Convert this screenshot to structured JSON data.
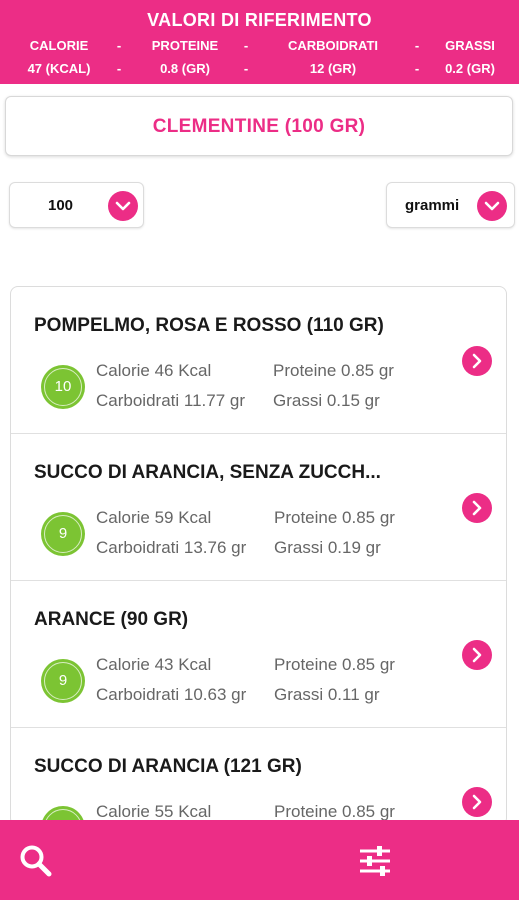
{
  "header": {
    "title": "VALORI DI RIFERIMENTO",
    "labels": {
      "calorie": "CALORIE",
      "proteine": "PROTEINE",
      "carboidrati": "CARBOIDRATI",
      "grassi": "GRASSI"
    },
    "values": {
      "calorie": "47 (KCAL)",
      "proteine": "0.8 (GR)",
      "carboidrati": "12 (GR)",
      "grassi": "0.2 (GR)"
    },
    "separator": "-"
  },
  "food": {
    "title": "CLEMENTINE   (100 GR)"
  },
  "quantity": {
    "value": "100",
    "icon": "chevron-down-icon"
  },
  "unit": {
    "value": "grammi",
    "icon": "chevron-down-icon"
  },
  "items": [
    {
      "name": "POMPELMO, ROSA E ROSSO (110 GR)",
      "score": "10",
      "calorie": "Calorie 46 Kcal",
      "proteine": "Proteine 0.85 gr",
      "carboidrati": "Carboidrati 11.77 gr",
      "grassi": "Grassi 0.15 gr"
    },
    {
      "name": "SUCCO DI ARANCIA, SENZA ZUCCH...",
      "score": "9",
      "calorie": "Calorie 59 Kcal",
      "proteine": "Proteine 0.85 gr",
      "carboidrati": "Carboidrati 13.76 gr",
      "grassi": "Grassi 0.19 gr"
    },
    {
      "name": "ARANCE (90 GR)",
      "score": "9",
      "calorie": "Calorie 43 Kcal",
      "proteine": "Proteine 0.85 gr",
      "carboidrati": "Carboidrati 10.63 gr",
      "grassi": "Grassi 0.11 gr"
    },
    {
      "name": "SUCCO DI ARANCIA (121 GR)",
      "score": "",
      "calorie": "Calorie 55 Kcal",
      "proteine": "Proteine 0.85 gr",
      "carboidrati": "",
      "grassi": ""
    }
  ],
  "footer": {
    "search_icon": "search-icon",
    "filter_icon": "sliders-icon"
  },
  "colors": {
    "accent": "#ec2d86",
    "badge": "#7cc433"
  }
}
